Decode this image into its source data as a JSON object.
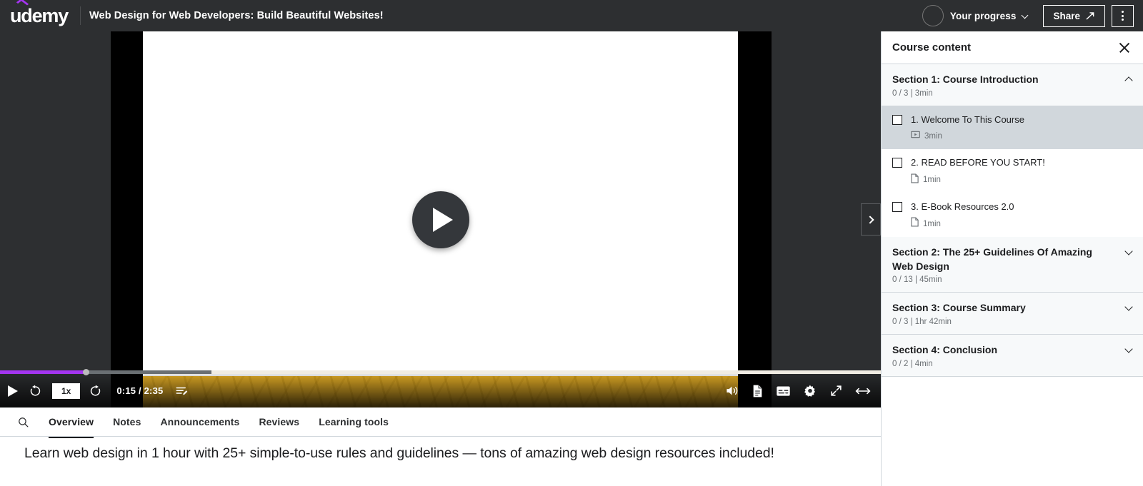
{
  "topbar": {
    "logo_text": "udemy",
    "logo_icon": "udemy-graduation-cap-icon",
    "course_title": "Web Design for Web Developers: Build Beautiful Websites!",
    "progress_label": "Your progress",
    "progress_chevron_icon": "chevron-down-icon",
    "share_label": "Share",
    "share_icon": "share-arrow-icon",
    "more_icon": "kebab-menu-icon",
    "background": "#2d2f31",
    "accent": "#a435f0"
  },
  "player": {
    "play_icon": "play-triangle-icon",
    "rewind_label": "",
    "rewind_icon": "rewind-5s-icon",
    "forward_icon": "forward-5s-icon",
    "speed_label": "1x",
    "timecode": "0:15 / 2:35",
    "current_time": "0:15",
    "duration": "2:35",
    "transcript_icon": "transcript-icon",
    "volume_icon": "volume-icon",
    "resources_icon": "document-icon",
    "captions_icon": "closed-captions-icon",
    "settings_icon": "gear-icon",
    "fullscreen_icon": "expand-icon",
    "theater_icon": "theater-mode-icon",
    "progress": {
      "played_pct": 9.7,
      "buffered_pct": 24,
      "played_color": "#a435f0",
      "buffer_color": "#6a6f73",
      "track_color": "#f0ece3"
    },
    "sidebar_toggle_icon": "chevron-right-icon"
  },
  "tabs": {
    "search_icon": "search-icon",
    "items": [
      {
        "label": "Overview",
        "active": true
      },
      {
        "label": "Notes",
        "active": false
      },
      {
        "label": "Announcements",
        "active": false
      },
      {
        "label": "Reviews",
        "active": false
      },
      {
        "label": "Learning tools",
        "active": false
      }
    ]
  },
  "overview": {
    "headline": "Learn web design in 1 hour with 25+ simple-to-use rules and guidelines — tons of amazing web design resources included!"
  },
  "sidebar": {
    "title": "Course content",
    "close_icon": "close-icon",
    "sections": [
      {
        "name": "Section 1: Course Introduction",
        "meta": "0 / 3 | 3min",
        "expanded": true,
        "chevron_icon": "chevron-up-icon",
        "lectures": [
          {
            "title": "1. Welcome To This Course",
            "duration": "3min",
            "type_icon": "video-icon",
            "current": true,
            "checked": false
          },
          {
            "title": "2. READ BEFORE YOU START!",
            "duration": "1min",
            "type_icon": "article-icon",
            "current": false,
            "checked": false
          },
          {
            "title": "3. E-Book Resources 2.0",
            "duration": "1min",
            "type_icon": "article-icon",
            "current": false,
            "checked": false
          }
        ]
      },
      {
        "name": "Section 2: The 25+ Guidelines Of Amazing Web Design",
        "meta": "0 / 13 | 45min",
        "expanded": false,
        "chevron_icon": "chevron-down-icon",
        "lectures": []
      },
      {
        "name": "Section 3: Course Summary",
        "meta": "0 / 3 | 1hr 42min",
        "expanded": false,
        "chevron_icon": "chevron-down-icon",
        "lectures": []
      },
      {
        "name": "Section 4: Conclusion",
        "meta": "0 / 2 | 4min",
        "expanded": false,
        "chevron_icon": "chevron-down-icon",
        "lectures": []
      }
    ]
  }
}
